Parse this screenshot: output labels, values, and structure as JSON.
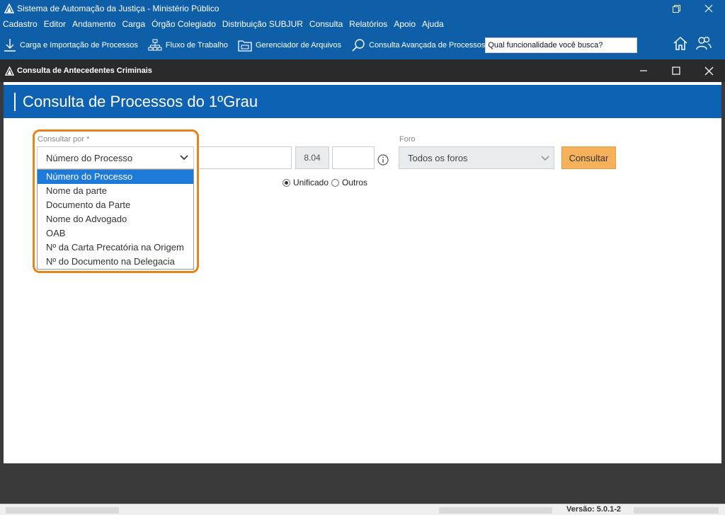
{
  "app": {
    "title": "Sistema de Automação da Justiça - Ministério Público",
    "colors": {
      "primary": "#0f5fa8",
      "accent": "#f6b15a",
      "highlight": "#e8821a",
      "selected": "#1e7ad8"
    }
  },
  "menu": [
    "Cadastro",
    "Editor",
    "Andamento",
    "Carga",
    "Órgão Colegiado",
    "Distribuição SUBJUR",
    "Consulta",
    "Relatórios",
    "Apoio",
    "Ajuda"
  ],
  "toolbar": {
    "items": [
      {
        "label": "Carga e Importação de Processos",
        "icon": "download-icon"
      },
      {
        "label": "Fluxo de Trabalho",
        "icon": "workflow-icon"
      },
      {
        "label": "Gerenciador de Arquivos",
        "icon": "file-manager-icon"
      },
      {
        "label": "Consulta Avançada de Processos",
        "icon": "advanced-search-icon"
      }
    ],
    "search_value": "Qual funcionalidade você busca?"
  },
  "subwindow": {
    "title": "Consulta de Antecedentes Criminais"
  },
  "page": {
    "title": "Consulta de Processos do 1ºGrau"
  },
  "form": {
    "consultar_por_label": "Consultar por *",
    "consultar_por_value": "Número do Processo",
    "number_middle": "8.04",
    "foro_label": "Foro",
    "foro_value": "Todos os foros",
    "consult_button": "Consultar",
    "radio_unificado": "Unificado",
    "radio_outros": "Outros",
    "radio_selected": "Unificado"
  },
  "dropdown": {
    "options": [
      "Número do Processo",
      "Nome da parte",
      "Documento da Parte",
      "Nome do Advogado",
      "OAB",
      "Nº da Carta Precatória na Origem",
      "Nº do Documento na Delegacia"
    ],
    "selected": "Número do Processo"
  },
  "status": {
    "version": "Versão: 5.0.1-2"
  }
}
